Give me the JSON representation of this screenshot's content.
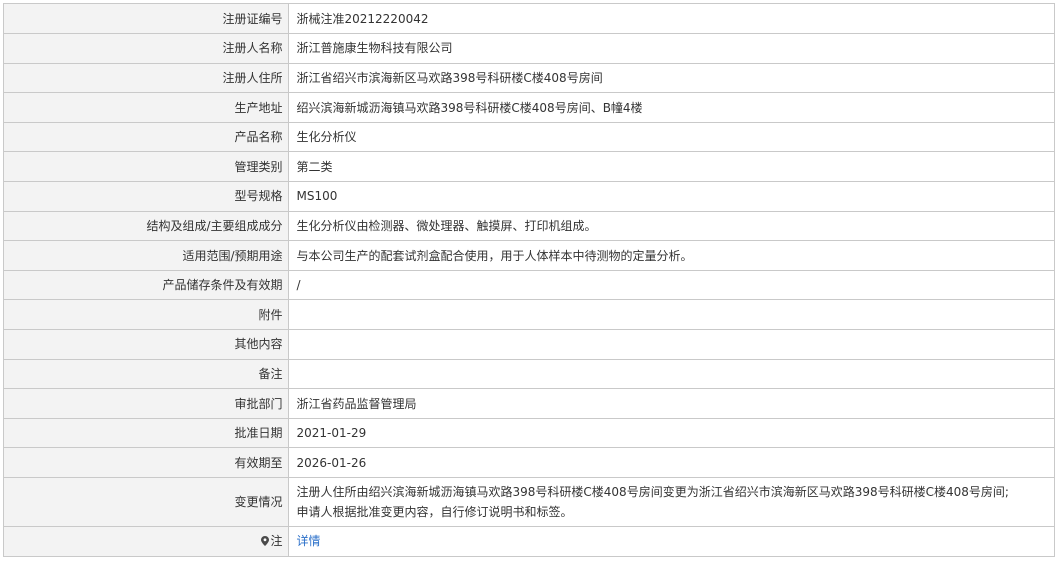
{
  "rows": [
    {
      "label": "注册证编号",
      "value": "浙械注准20212220042"
    },
    {
      "label": "注册人名称",
      "value": "浙江普施康生物科技有限公司"
    },
    {
      "label": "注册人住所",
      "value": "浙江省绍兴市滨海新区马欢路398号科研楼C楼408号房间"
    },
    {
      "label": "生产地址",
      "value": "绍兴滨海新城沥海镇马欢路398号科研楼C楼408号房间、B幢4楼"
    },
    {
      "label": "产品名称",
      "value": "生化分析仪"
    },
    {
      "label": "管理类别",
      "value": "第二类"
    },
    {
      "label": "型号规格",
      "value": "MS100"
    },
    {
      "label": "结构及组成/主要组成成分",
      "value": "生化分析仪由检测器、微处理器、触摸屏、打印机组成。"
    },
    {
      "label": "适用范围/预期用途",
      "value": "与本公司生产的配套试剂盒配合使用，用于人体样本中待测物的定量分析。"
    },
    {
      "label": "产品储存条件及有效期",
      "value": "/"
    },
    {
      "label": "附件",
      "value": ""
    },
    {
      "label": "其他内容",
      "value": ""
    },
    {
      "label": "备注",
      "value": ""
    },
    {
      "label": "审批部门",
      "value": "浙江省药品监督管理局"
    },
    {
      "label": "批准日期",
      "value": "2021-01-29"
    },
    {
      "label": "有效期至",
      "value": "2026-01-26"
    }
  ],
  "change": {
    "label": "变更情况",
    "line1": "注册人住所由绍兴滨海新城沥海镇马欢路398号科研楼C楼408号房间变更为浙江省绍兴市滨海新区马欢路398号科研楼C楼408号房间;",
    "line2": "申请人根据批准变更内容，自行修订说明书和标签。"
  },
  "note": {
    "label": "注",
    "icon": "pin-icon",
    "link_text": "详情",
    "link_color": "#2a6fc9"
  }
}
